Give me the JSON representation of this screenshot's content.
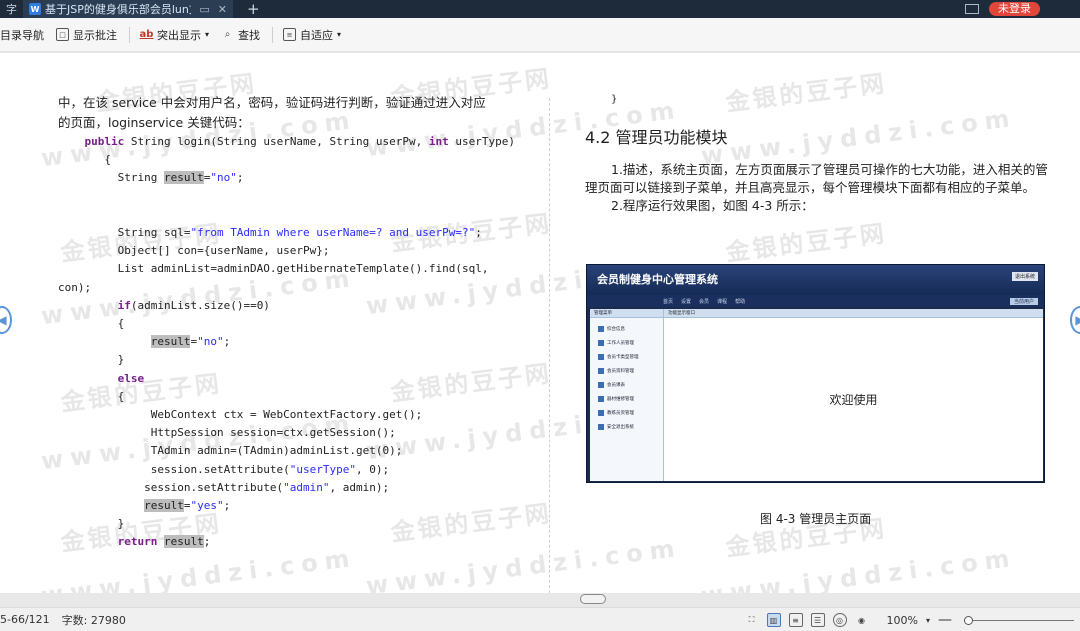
{
  "titlebar": {
    "left_tab_label": "字",
    "doc_tab_title": "基于JSP的健身俱乐部会员lun文",
    "login_label": "未登录"
  },
  "toolbar": {
    "items": [
      {
        "label": "目录导航",
        "icon": "list-icon"
      },
      {
        "label": "显示批注",
        "icon": "comment-icon"
      },
      {
        "label": "突出显示",
        "icon": "highlight-icon",
        "dropdown": true
      },
      {
        "label": "查找",
        "icon": "search-icon"
      },
      {
        "label": "自适应",
        "icon": "fit-page-icon",
        "dropdown": true
      }
    ]
  },
  "left_page": {
    "intro_line1": "中，在该 service 中会对用户名，密码，验证码进行判断，验证通过进入对应",
    "intro_line2": "的页面，loginservice 关键代码："
  },
  "right_page": {
    "brace": "}",
    "heading": "4.2  管理员功能模块",
    "desc_para": "1.描述，系统主页面，左方页面展示了管理员可操作的七大功能，进入相关的管理页面可以链接到子菜单，并且高亮显示，每个管理模块下面都有相应的子菜单。",
    "run_para": "2.程序运行效果图，如图 4-3 所示：",
    "figure": {
      "title": "会员制健身中心管理系统",
      "header_btn": "退出系统",
      "nav_items": [
        "首页",
        "设置",
        "会员",
        "课程",
        "帮助"
      ],
      "user_label": "当前用户",
      "sidebar_head": "管理菜单",
      "sidebar_items": [
        "综合信息",
        "工作人员管理",
        "会员卡类型管理",
        "会员资料管理",
        "会员课表",
        "器材维修管理",
        "教练员资管理",
        "安全退出系统"
      ],
      "main_tab": "功能显示窗口",
      "welcome": "欢迎使用"
    },
    "caption": "图 4-3  管理员主页面"
  },
  "watermark": {
    "cn": "金银的豆子网",
    "en": "www.jyddzi.com"
  },
  "statusbar": {
    "page_info": "5-66/121",
    "word_count": "字数: 27980",
    "zoom": "100%"
  }
}
